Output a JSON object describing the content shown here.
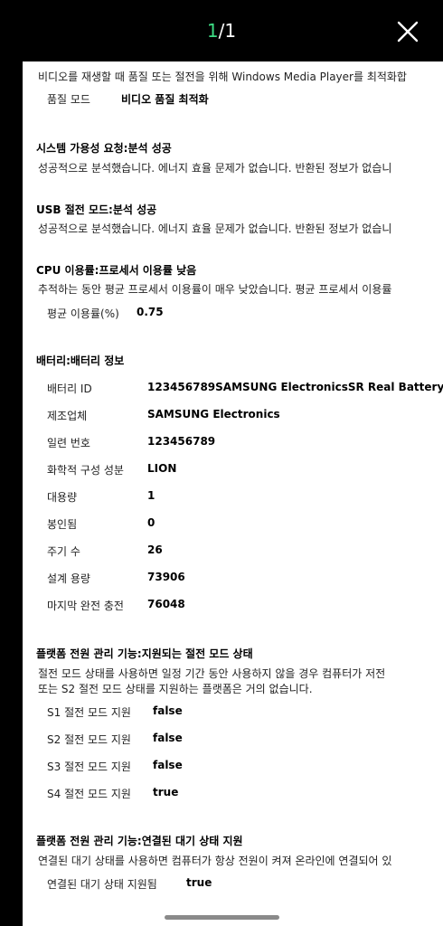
{
  "viewer": {
    "current_page": "1",
    "page_sep": "/",
    "total_pages": "1",
    "close_icon": "close-icon"
  },
  "doc": {
    "multimedia": {
      "desc": "비디오를 재생할 때 품질 또는 절전을 위해 Windows Media Player를 최적화합",
      "quality_label": "품질 모드",
      "quality_value": "비디오 품질 최적화"
    },
    "availability": {
      "heading": "시스템 가용성 요청:분석 성공",
      "desc": "성공적으로 분석했습니다. 에너지 효율 문제가 없습니다. 반환된 정보가 없습니"
    },
    "usb": {
      "heading": "USB 절전 모드:분석 성공",
      "desc": "성공적으로 분석했습니다. 에너지 효율 문제가 없습니다. 반환된 정보가 없습니"
    },
    "cpu": {
      "heading": "CPU 이용률:프로세서 이용률 낮음",
      "desc": "추적하는 동안 평균 프로세서 이용률이 매우 낮았습니다. 평균 프로세서 이용률",
      "avg_label": "평균 이용률(%)",
      "avg_value": "0.75"
    },
    "battery": {
      "heading": "배터리:배터리 정보",
      "rows": [
        {
          "label": "배터리 ID",
          "value": "123456789SAMSUNG ElectronicsSR Real Battery"
        },
        {
          "label": "제조업체",
          "value": "SAMSUNG Electronics"
        },
        {
          "label": "일련 번호",
          "value": "123456789"
        },
        {
          "label": "화학적 구성 성분",
          "value": "LION"
        },
        {
          "label": "대용량",
          "value": "1"
        },
        {
          "label": "봉인됨",
          "value": "0"
        },
        {
          "label": "주기 수",
          "value": "26"
        },
        {
          "label": "설계 용량",
          "value": "73906"
        },
        {
          "label": "마지막 완전 충전",
          "value": "76048"
        }
      ]
    },
    "sleep_states": {
      "heading": "플랫폼 전원 관리 기능:지원되는 절전 모드 상태",
      "desc_line1": "절전 모드 상태를 사용하면 일정 기간 동안 사용하지 않을 경우 컴퓨터가 저전",
      "desc_line2": "또는 S2 절전 모드 상태를 지원하는 플랫폼은 거의 없습니다.",
      "rows": [
        {
          "label": "S1 절전 모드 지원",
          "value": "false"
        },
        {
          "label": "S2 절전 모드 지원",
          "value": "false"
        },
        {
          "label": "S3 절전 모드 지원",
          "value": "false"
        },
        {
          "label": "S4 절전 모드 지원",
          "value": "true"
        }
      ]
    },
    "connected_standby": {
      "heading": "플랫폼 전원 관리 기능:연결된 대기 상태 지원",
      "desc": "연결된 대기 상태를 사용하면 컴퓨터가 항상 전원이 켜져 온라인에 연결되어 있",
      "label": "연결된 대기 상태 지원됨",
      "value": "true"
    }
  }
}
